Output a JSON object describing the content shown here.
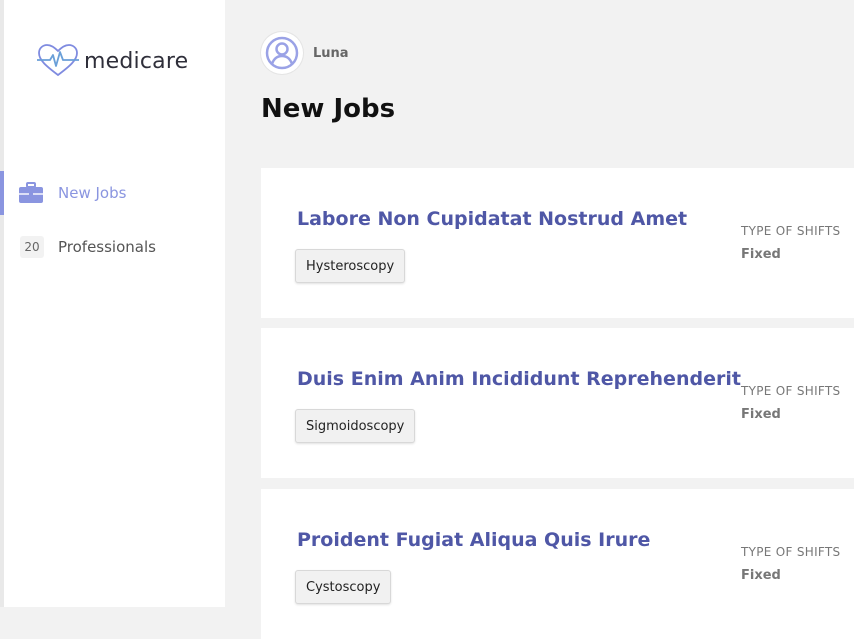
{
  "brand": {
    "name": "medicare",
    "accent": "#8a95e0"
  },
  "sidebar": {
    "items": [
      {
        "label": "New Jobs",
        "icon": "briefcase-icon",
        "active": true
      },
      {
        "label": "Professionals",
        "badge": "20",
        "active": false
      }
    ]
  },
  "user": {
    "name": "Luna",
    "icon": "user-avatar-icon"
  },
  "page": {
    "title": "New Jobs"
  },
  "jobs": [
    {
      "title": "Labore Non Cupidatat Nostrud Amet",
      "tag": "Hysteroscopy",
      "meta_label": "TYPE OF SHIFTS",
      "meta_value": "Fixed"
    },
    {
      "title": "Duis Enim Anim Incididunt Reprehenderit",
      "tag": "Sigmoidoscopy",
      "meta_label": "TYPE OF SHIFTS",
      "meta_value": "Fixed"
    },
    {
      "title": "Proident Fugiat Aliqua Quis Irure",
      "tag": "Cystoscopy",
      "meta_label": "TYPE OF SHIFTS",
      "meta_value": "Fixed"
    }
  ],
  "colors": {
    "title": "#4f57a6",
    "background": "#f2f2f2"
  }
}
